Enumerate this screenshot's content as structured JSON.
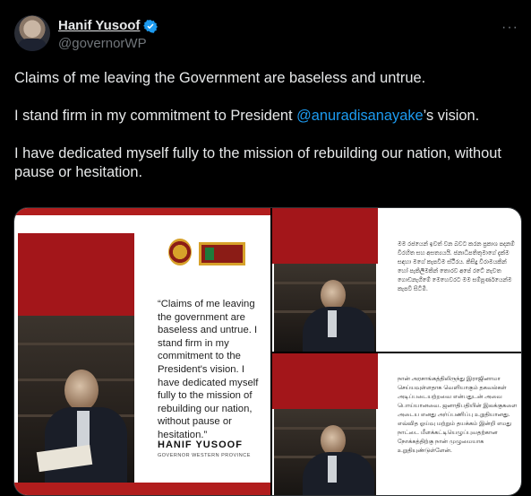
{
  "author": {
    "name": "Hanif Yusoof",
    "handle": "@governorWP"
  },
  "more_label": "···",
  "tweet": {
    "line1": "Claims of me leaving the Government are baseless and untrue.",
    "line2_before": "I stand firm in my commitment to President ",
    "line2_mention": "@anuradisanayake",
    "line2_after": "’s vision.",
    "line3": "I have dedicated myself fully to the mission of rebuilding our nation, without pause or hesitation."
  },
  "media": {
    "main": {
      "quote": "“Claims of me leaving the government are baseless and untrue. I stand firm in my commitment to the President's vision. I have dedicated myself fully to the mission of rebuilding our nation, without pause or hesitation.”",
      "signature_name": "HANIF YUSOOF",
      "signature_title": "GOVERNOR WESTERN PROVINCE"
    },
    "top_right_text": "මම රජයෙන් ඉවත් වන බවට කරන ප්‍රකාශ පදනම් විරහිත සහ අසත්‍යයයි. ජනාධිපතිතුමාගේ දැක්ම සඳහා මගේ කැපවීම ස්ථිරය. කිසිදු විරාමයකින් හෝ පැකිලීමකින් තොරව අපේ රටේ නැවත ගොඩනැගීමේ මෙහෙවරට මම සම්පූර්ණයෙන්ම කැපවී සිටිමි.",
    "bottom_right_text": "நான் அரசாங்கத்திலிருந்து இராஜினாமா செய்யவுள்ளதாக வெளியாகும் தகவல்கள் அடிப்படையற்றவை என்பதுடன் அவை பொய்யானவை. ஜனாதிபதியின் இலக்குகளை அடைய எனது அர்ப்பணிப்பு உறுதியானது. எவ்வித ஓய்வு மற்றும் தயக்கம் இன்றி எமது நாட்டை மீளக்கட்டியெழுப்புவதற்கான நோக்கத்திற்கு நான் முழுமையாக உறுதியுண்டுள்ளேன்."
  },
  "colors": {
    "accent": "#1d9bf0",
    "brand_red": "#a3161a"
  }
}
